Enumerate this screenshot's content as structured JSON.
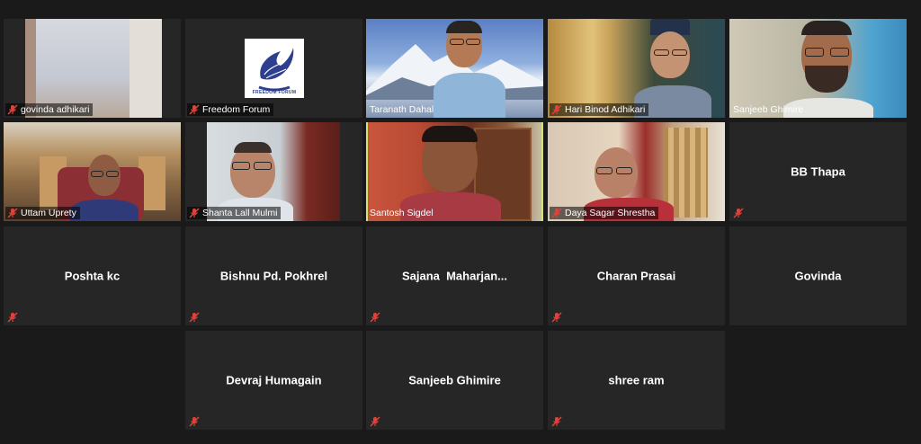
{
  "participants": [
    {
      "name": "govinda adhikari",
      "muted": true
    },
    {
      "name": "Freedom Forum",
      "muted": true
    },
    {
      "name": "Taranath Dahal",
      "muted": false
    },
    {
      "name": "Hari Binod Adhikari",
      "muted": true
    },
    {
      "name": "Sanjeeb Ghimire",
      "muted": false
    },
    {
      "name": "Uttam Uprety",
      "muted": true
    },
    {
      "name": "Shanta Lall Mulmi",
      "muted": true
    },
    {
      "name": "Santosh Sigdel",
      "muted": false,
      "active_speaker": true
    },
    {
      "name": "Daya Sagar Shrestha",
      "muted": true
    },
    {
      "name": "BB Thapa",
      "muted": true
    },
    {
      "name": "Poshta kc",
      "muted": true
    },
    {
      "name": "Bishnu Pd. Pokhrel",
      "muted": true
    },
    {
      "name": "Sajana  Maharjan...",
      "muted": true
    },
    {
      "name": "Charan Prasai",
      "muted": true
    },
    {
      "name": "Govinda",
      "muted": true
    },
    {
      "name": "Devraj Humagain",
      "muted": true
    },
    {
      "name": "Sanjeeb Ghimire",
      "muted": true
    },
    {
      "name": "shree ram",
      "muted": true
    }
  ],
  "logo": {
    "text": "FREEDOM FORUM"
  },
  "colors": {
    "active_outline": "#d6e36a",
    "muted_icon": "#e0423a",
    "tile_bg": "#262626"
  },
  "icons": {
    "muted": "muted-mic-icon"
  }
}
